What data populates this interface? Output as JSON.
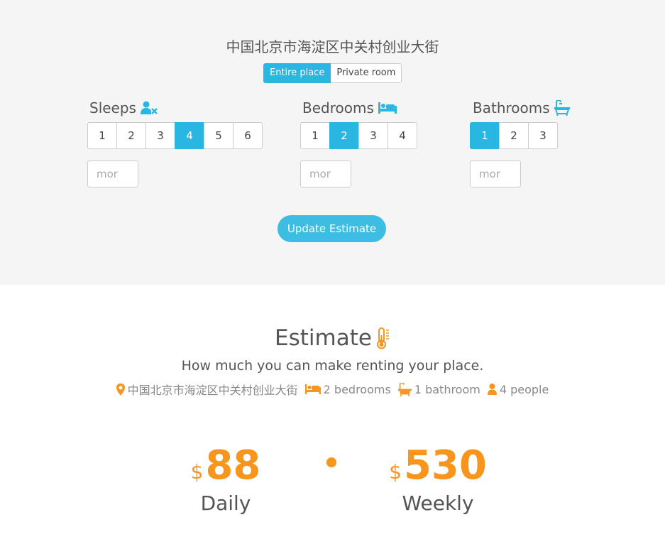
{
  "search": {
    "address": "中国北京市海淀区中关村创业大街",
    "room_types": [
      "Entire place",
      "Private room"
    ],
    "selected_room_type": "Entire place",
    "sleeps": {
      "label": "Sleeps",
      "icon": "user-x-icon",
      "options": [
        "1",
        "2",
        "3",
        "4",
        "5",
        "6"
      ],
      "selected": "4",
      "more_placeholder": "mor"
    },
    "bedrooms": {
      "label": "Bedrooms",
      "icon": "bed-icon",
      "options": [
        "1",
        "2",
        "3",
        "4"
      ],
      "selected": "2",
      "more_placeholder": "mor"
    },
    "bathrooms": {
      "label": "Bathrooms",
      "icon": "bathtub-icon",
      "options": [
        "1",
        "2",
        "3"
      ],
      "selected": "1",
      "more_placeholder": "mor"
    },
    "update_label": "Update Estimate"
  },
  "estimate": {
    "title": "Estimate",
    "subtitle": "How much you can make renting your place.",
    "summary": {
      "address": "中国北京市海淀区中关村创业大街",
      "bedrooms": "2 bedrooms",
      "bathrooms": "1 bathroom",
      "people": "4 people"
    },
    "daily": {
      "currency": "$",
      "value": "88",
      "label": "Daily"
    },
    "weekly": {
      "currency": "$",
      "value": "530",
      "label": "Weekly"
    }
  },
  "colors": {
    "accent_blue": "#29b6e0",
    "accent_orange": "#f7951d",
    "panel_bg": "#f5f5f5"
  }
}
